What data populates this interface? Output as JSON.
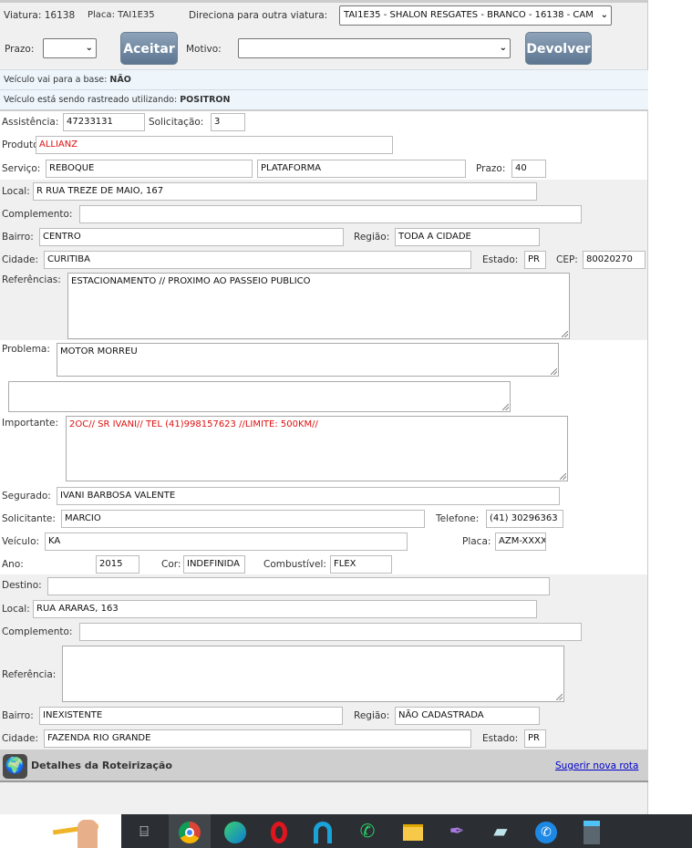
{
  "header": {
    "viatura_label": "Viatura:",
    "viatura": "16138",
    "placa_label": "Placa:",
    "placa": "TAI1E35",
    "direciona_label": "Direciona para outra viatura:",
    "direciona_value": "TAI1E35 - SHALON RESGATES - BRANCO - 16138 - CAM",
    "prazo_label": "Prazo:",
    "prazo_value": "",
    "aceitar": "Aceitar",
    "motivo_label": "Motivo:",
    "motivo_value": "",
    "devolver": "Devolver"
  },
  "info": {
    "base_label": "Veículo vai para a base:",
    "base_value": "NÃO",
    "rastreio_label": "Veículo está sendo rastreado utilizando:",
    "rastreio_value": "POSITRON"
  },
  "form": {
    "assistencia_label": "Assistência:",
    "assistencia": "47233131",
    "solicitacao_label": "Solicitação:",
    "solicitacao": "3",
    "produto_label": "Produto:",
    "produto": "ALLIANZ",
    "servico_label": "Serviço:",
    "servico": "REBOQUE",
    "servico2": "PLATAFORMA",
    "prazo_label": "Prazo:",
    "prazo": "40",
    "local_label": "Local:",
    "local": "R RUA TREZE DE MAIO, 167",
    "complemento_label": "Complemento:",
    "complemento": "",
    "bairro_label": "Bairro:",
    "bairro": "CENTRO",
    "regiao_label": "Região:",
    "regiao": "TODA A CIDADE",
    "cidade_label": "Cidade:",
    "cidade": "CURITIBA",
    "estado_label": "Estado:",
    "estado": "PR",
    "cep_label": "CEP:",
    "cep": "80020270",
    "referencias_label": "Referências:",
    "referencias": "ESTACIONAMENTO // PROXIMO AO PASSEIO PUBLICO",
    "problema_label": "Problema:",
    "problema": "MOTOR MORREU",
    "problema_extra": "",
    "importante_label": "Importante:",
    "importante": "2OC// SR IVANI// TEL  (41)998157623 //LIMITE: 500KM//",
    "segurado_label": "Segurado:",
    "segurado": "IVANI BARBOSA VALENTE",
    "solicitante_label": "Solicitante:",
    "solicitante": "MARCIO",
    "telefone_label": "Telefone:",
    "telefone": "(41) 30296363",
    "veiculo_label": "Veículo:",
    "veiculo": "KA",
    "placa_label": "Placa:",
    "placa": "AZM-XXXX",
    "ano_label": "Ano:",
    "ano": "2015",
    "cor_label": "Cor:",
    "cor": "INDEFINIDA",
    "combustivel_label": "Combustível:",
    "combustivel": "FLEX"
  },
  "destino": {
    "destino_label": "Destino:",
    "destino": "",
    "local_label": "Local:",
    "local": "RUA ARARAS, 163",
    "complemento_label": "Complemento:",
    "complemento": "",
    "referencia_label": "Referência:",
    "referencia": "",
    "bairro_label": "Bairro:",
    "bairro": "INEXISTENTE",
    "regiao_label": "Região:",
    "regiao": "NÃO CADASTRADA",
    "cidade_label": "Cidade:",
    "cidade": "FAZENDA RIO GRANDE",
    "estado_label": "Estado:",
    "estado": "PR"
  },
  "roteirizacao": {
    "title": "Detalhes da Roteirização",
    "link": "Sugerir nova rota"
  },
  "taskbar": {
    "icons": [
      "task-view",
      "chrome",
      "edge",
      "opera",
      "app-a",
      "whatsapp",
      "file-explorer",
      "feather",
      "notepad",
      "phone",
      "calculator"
    ]
  }
}
